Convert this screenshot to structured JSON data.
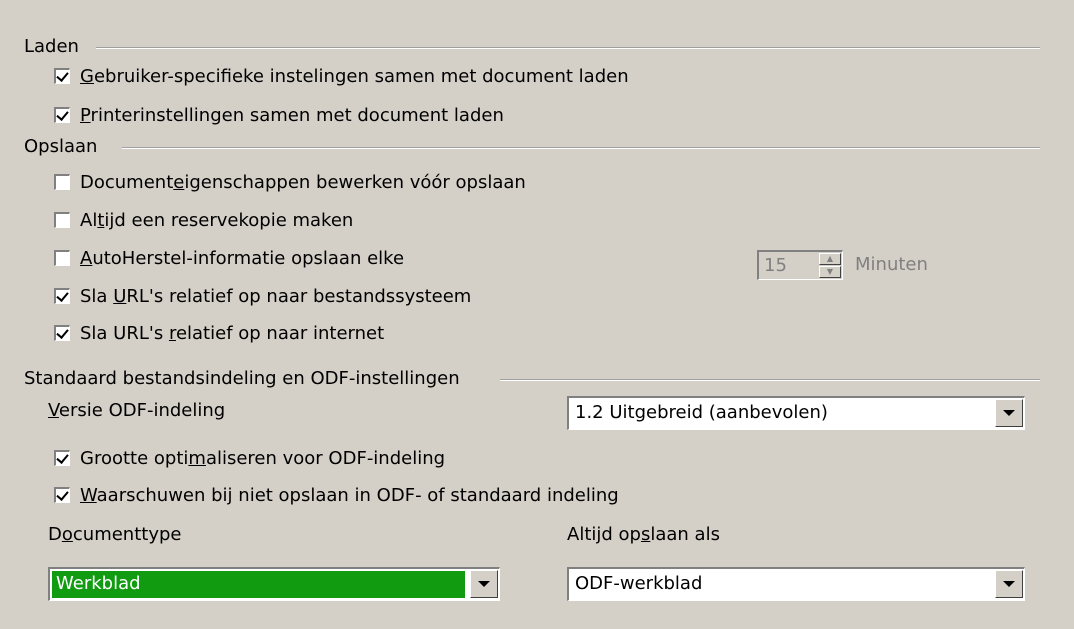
{
  "sections": {
    "laden": "Laden",
    "opslaan": "Opslaan",
    "standaard": "Standaard bestandsindeling en ODF-instellingen"
  },
  "load": {
    "user_settings": {
      "label_pre": "",
      "label_key": "G",
      "label_post": "ebruiker-specifieke instelingen samen met document laden",
      "checked": true
    },
    "printer_settings": {
      "label_pre": "",
      "label_key": "P",
      "label_post": "rinterinstellingen samen met document laden",
      "checked": true
    }
  },
  "save": {
    "doc_props": {
      "label_pre": "Document",
      "label_key": "e",
      "label_post": "igenschappen bewerken vóór opslaan",
      "checked": false
    },
    "backup": {
      "label_pre": "Al",
      "label_key": "t",
      "label_post": "ijd een reservekopie maken",
      "checked": false
    },
    "autorecovery": {
      "label_pre": "",
      "label_key": "A",
      "label_post": "utoHerstel-informatie opslaan elke",
      "checked": false,
      "value": "15",
      "unit": "Minuten"
    },
    "url_fs": {
      "label_pre": "Sla ",
      "label_key": "U",
      "label_post": "RL's relatief op naar bestandssysteem",
      "checked": true
    },
    "url_inet": {
      "label_pre": "Sla URL's ",
      "label_key": "r",
      "label_post": "elatief op naar internet",
      "checked": true
    }
  },
  "odf": {
    "version_label_pre": "",
    "version_label_key": "V",
    "version_label_post": "ersie ODF-indeling",
    "version_value": "1.2 Uitgebreid (aanbevolen)",
    "optimize": {
      "label_pre": "Grootte opti",
      "label_key": "m",
      "label_post": "aliseren voor ODF-indeling",
      "checked": true
    },
    "warn": {
      "label_pre": "",
      "label_key": "W",
      "label_post": "aarschuwen bij niet opslaan in ODF- of standaard indeling",
      "checked": true
    },
    "doctype_label_pre": "D",
    "doctype_label_key": "o",
    "doctype_label_post": "cumenttype",
    "doctype_value": "Werkblad",
    "saveas_label_pre": "Altijd op",
    "saveas_label_key": "s",
    "saveas_label_post": "laan als",
    "saveas_value": "ODF-werkblad"
  },
  "colors": {
    "background": "#d4d0c8",
    "selection": "#109b10"
  }
}
